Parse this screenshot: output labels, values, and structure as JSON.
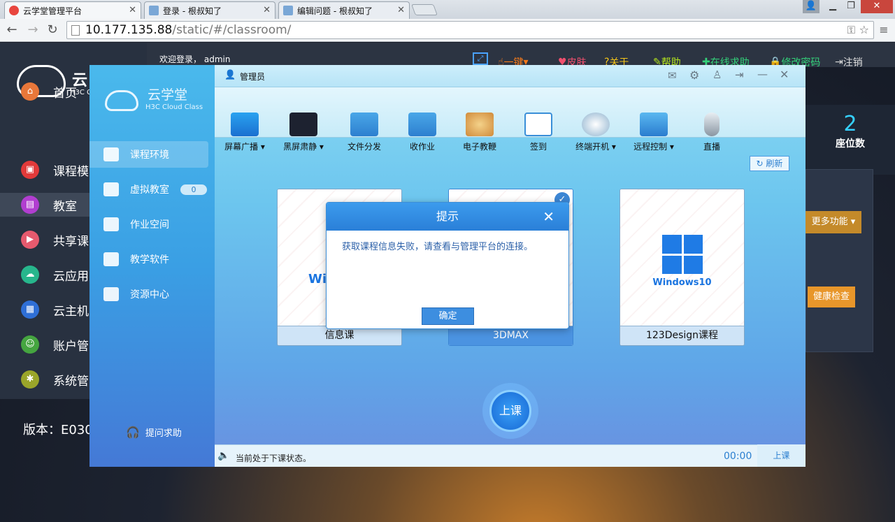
{
  "browser": {
    "tabs": [
      {
        "title": "云学堂管理平台",
        "active": true
      },
      {
        "title": "登录 - 根叔知了",
        "active": false
      },
      {
        "title": "编辑问题 - 根叔知了",
        "active": false
      }
    ],
    "url_host": "10.177.135.88",
    "url_path": "/static/#/classroom/"
  },
  "portal": {
    "welcome": "欢迎登录，",
    "user": "admin",
    "top_nav": [
      "一键",
      "皮肤",
      "关于",
      "帮助",
      "在线求助",
      "修改密码",
      "注销"
    ],
    "logo_text": "云",
    "logo_sub": "H3C C",
    "sidebar": [
      {
        "label": "首页",
        "icon": "home-icon",
        "color": "#e8773a"
      },
      {
        "label": "课程模",
        "icon": "course-icon",
        "color": "#e23a3a"
      },
      {
        "label": "教室",
        "icon": "classroom-icon",
        "color": "#b13ed0",
        "active": true
      },
      {
        "label": "共享课",
        "icon": "share-icon",
        "color": "#e65a6e"
      },
      {
        "label": "云应用",
        "icon": "cloud-app-icon",
        "color": "#27b68c"
      },
      {
        "label": "云主机",
        "icon": "host-icon",
        "color": "#2f6fd6"
      },
      {
        "label": "账户管",
        "icon": "account-icon",
        "color": "#45a540"
      },
      {
        "label": "系统管",
        "icon": "system-icon",
        "color": "#9aa52a"
      }
    ],
    "version": "版本：E030",
    "seats_value": "2",
    "seats_label": "座位数",
    "more_btn": "更多功能",
    "health_btn": "健康检查"
  },
  "app": {
    "brand": "云学堂",
    "brand_sub": "H3C Cloud Class",
    "admin_label": "管理员",
    "toolbar": [
      "屏幕广播",
      "黑屏肃静",
      "文件分发",
      "收作业",
      "电子教鞭",
      "签到",
      "终端开机",
      "远程控制",
      "直播"
    ],
    "left_nav": [
      {
        "label": "课程环境",
        "active": true
      },
      {
        "label": "虚拟教室",
        "badge": "0"
      },
      {
        "label": "作业空间"
      },
      {
        "label": "教学软件"
      },
      {
        "label": "资源中心"
      }
    ],
    "help_label": "提问求助",
    "refresh_label": "刷新",
    "courses": [
      {
        "name": "信息课",
        "os_text": "Wi"
      },
      {
        "name": "3DMAX",
        "selected": true
      },
      {
        "name": "123Design课程",
        "os_text": "Windows10"
      }
    ],
    "start_button": "上课",
    "status_text": "当前处于下课状态。",
    "timer": "00:00",
    "status_right": "上课"
  },
  "dialog": {
    "title": "提示",
    "message": "获取课程信息失败，请查看与管理平台的连接。",
    "ok": "确定"
  }
}
